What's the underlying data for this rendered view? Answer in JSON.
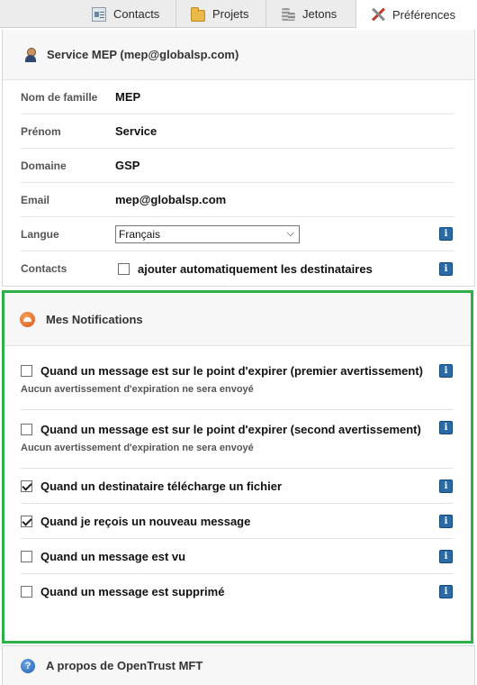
{
  "tabs": [
    {
      "label": "Contacts",
      "icon": "contacts-icon"
    },
    {
      "label": "Projets",
      "icon": "folder-icon"
    },
    {
      "label": "Jetons",
      "icon": "coins-icon"
    },
    {
      "label": "Préférences",
      "icon": "tools-icon",
      "active": true
    }
  ],
  "profile": {
    "title": "Service MEP (mep@globalsp.com)",
    "fields": {
      "nom_label": "Nom de famille",
      "nom_value": "MEP",
      "prenom_label": "Prénom",
      "prenom_value": "Service",
      "domaine_label": "Domaine",
      "domaine_value": "GSP",
      "email_label": "Email",
      "email_value": "mep@globalsp.com",
      "langue_label": "Langue",
      "langue_value": "Français",
      "contacts_label": "Contacts",
      "contacts_option": "ajouter automatiquement les destinataires",
      "contacts_checked": false
    }
  },
  "notifications": {
    "title": "Mes Notifications",
    "items": [
      {
        "label": "Quand un message est sur le point d'expirer (premier avertissement)",
        "checked": false,
        "note": "Aucun avertissement d'expiration ne sera envoyé"
      },
      {
        "label": "Quand un message est sur le point d'expirer (second avertissement)",
        "checked": false,
        "note": "Aucun avertissement d'expiration ne sera envoyé"
      },
      {
        "label": "Quand un destinataire télécharge un fichier",
        "checked": true
      },
      {
        "label": "Quand je reçois un nouveau message",
        "checked": true
      },
      {
        "label": "Quand un message est vu",
        "checked": false
      },
      {
        "label": "Quand un message est supprimé",
        "checked": false
      }
    ]
  },
  "about": {
    "title": "A propos de OpenTrust MFT"
  },
  "colors": {
    "highlight_border": "#2db04a",
    "info_icon": "#2a6aa6"
  }
}
